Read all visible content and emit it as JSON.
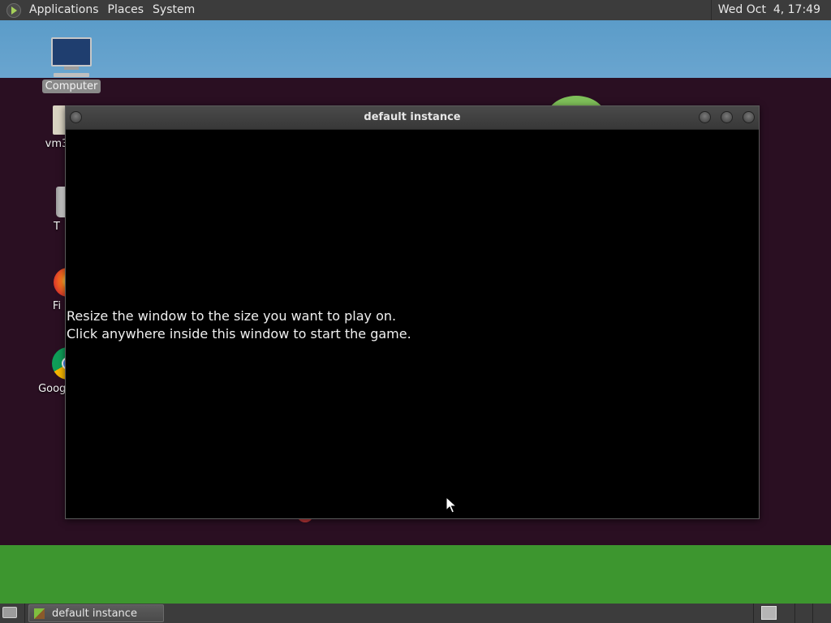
{
  "top_panel": {
    "menus": [
      "Applications",
      "Places",
      "System"
    ],
    "clock": "Wed Oct  4, 17:49"
  },
  "desktop_icons": {
    "computer": "Computer",
    "home": "vm3",
    "trash": "T",
    "firefox": "Fi",
    "chrome": "Google"
  },
  "window": {
    "title": "default instance",
    "message_line1": "Resize the window to the size you want to play on.",
    "message_line2": "Click anywhere inside this window to start the game."
  },
  "taskbar": {
    "task_label": "default instance"
  },
  "colors": {
    "panel": "#3c3c3c",
    "wallpaper": "#2a0f22",
    "sky": "#5b9cc9",
    "grass": "#3d962f"
  }
}
